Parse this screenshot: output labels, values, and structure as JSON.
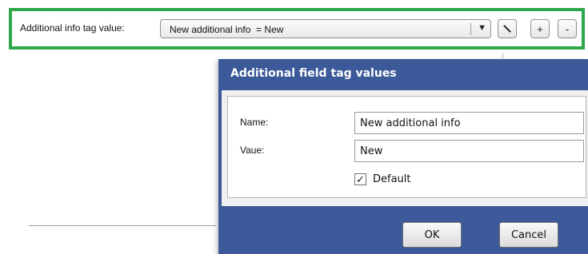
{
  "tag_bar": {
    "label": "Additional info tag value:",
    "selected_value": "New additional info  = New",
    "dropdown_arrow": "▼",
    "add_label": "+",
    "remove_label": "-",
    "highlight_color": "#2fa64a"
  },
  "dialog": {
    "title": "Additional field tag values",
    "name_label": "Name:",
    "name_value": "New additional info",
    "value_label": "Vaue:",
    "value_value": "New",
    "default_checked": "✓",
    "default_label": "Default",
    "ok_label": "OK",
    "cancel_label": "Cancel",
    "title_bar_color": "#3c5a99"
  },
  "icons": {
    "edit": "pencil-icon",
    "dropdown": "chevron-down-icon",
    "check": "checkmark-icon"
  }
}
